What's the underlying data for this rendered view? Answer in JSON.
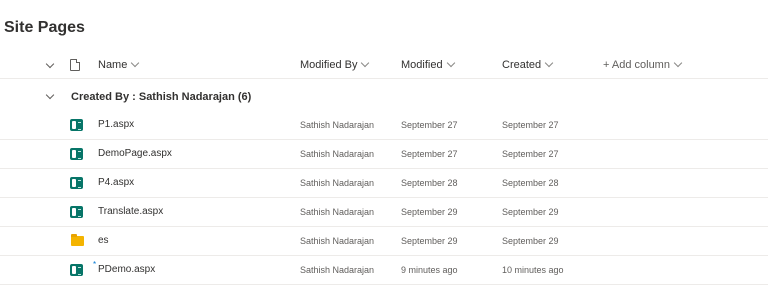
{
  "page": {
    "title": "Site Pages"
  },
  "columns": {
    "name": "Name",
    "modified_by": "Modified By",
    "modified": "Modified",
    "created": "Created",
    "add_column": "+ Add column"
  },
  "group": {
    "label": "Created By : Sathish Nadarajan (6)"
  },
  "rows": [
    {
      "name": "P1.aspx",
      "icon": "sitepage-icon",
      "modified_by": "Sathish Nadarajan",
      "modified": "September 27",
      "created": "September 27"
    },
    {
      "name": "DemoPage.aspx",
      "icon": "sitepage-icon",
      "modified_by": "Sathish Nadarajan",
      "modified": "September 27",
      "created": "September 27"
    },
    {
      "name": "P4.aspx",
      "icon": "sitepage-icon",
      "modified_by": "Sathish Nadarajan",
      "modified": "September 28",
      "created": "September 28"
    },
    {
      "name": "Translate.aspx",
      "icon": "sitepage-icon",
      "modified_by": "Sathish Nadarajan",
      "modified": "September 29",
      "created": "September 29"
    },
    {
      "name": "es",
      "icon": "folder-icon",
      "modified_by": "Sathish Nadarajan",
      "modified": "September 29",
      "created": "September 29"
    },
    {
      "name": "PDemo.aspx",
      "icon": "sitepage-icon",
      "new_mark": "*",
      "modified_by": "Sathish Nadarajan",
      "modified": "9 minutes ago",
      "created": "10 minutes ago"
    }
  ],
  "colors": {
    "sitepage_icon": "#077568",
    "folder_icon": "#f4b400",
    "row_border": "#edebe9"
  }
}
